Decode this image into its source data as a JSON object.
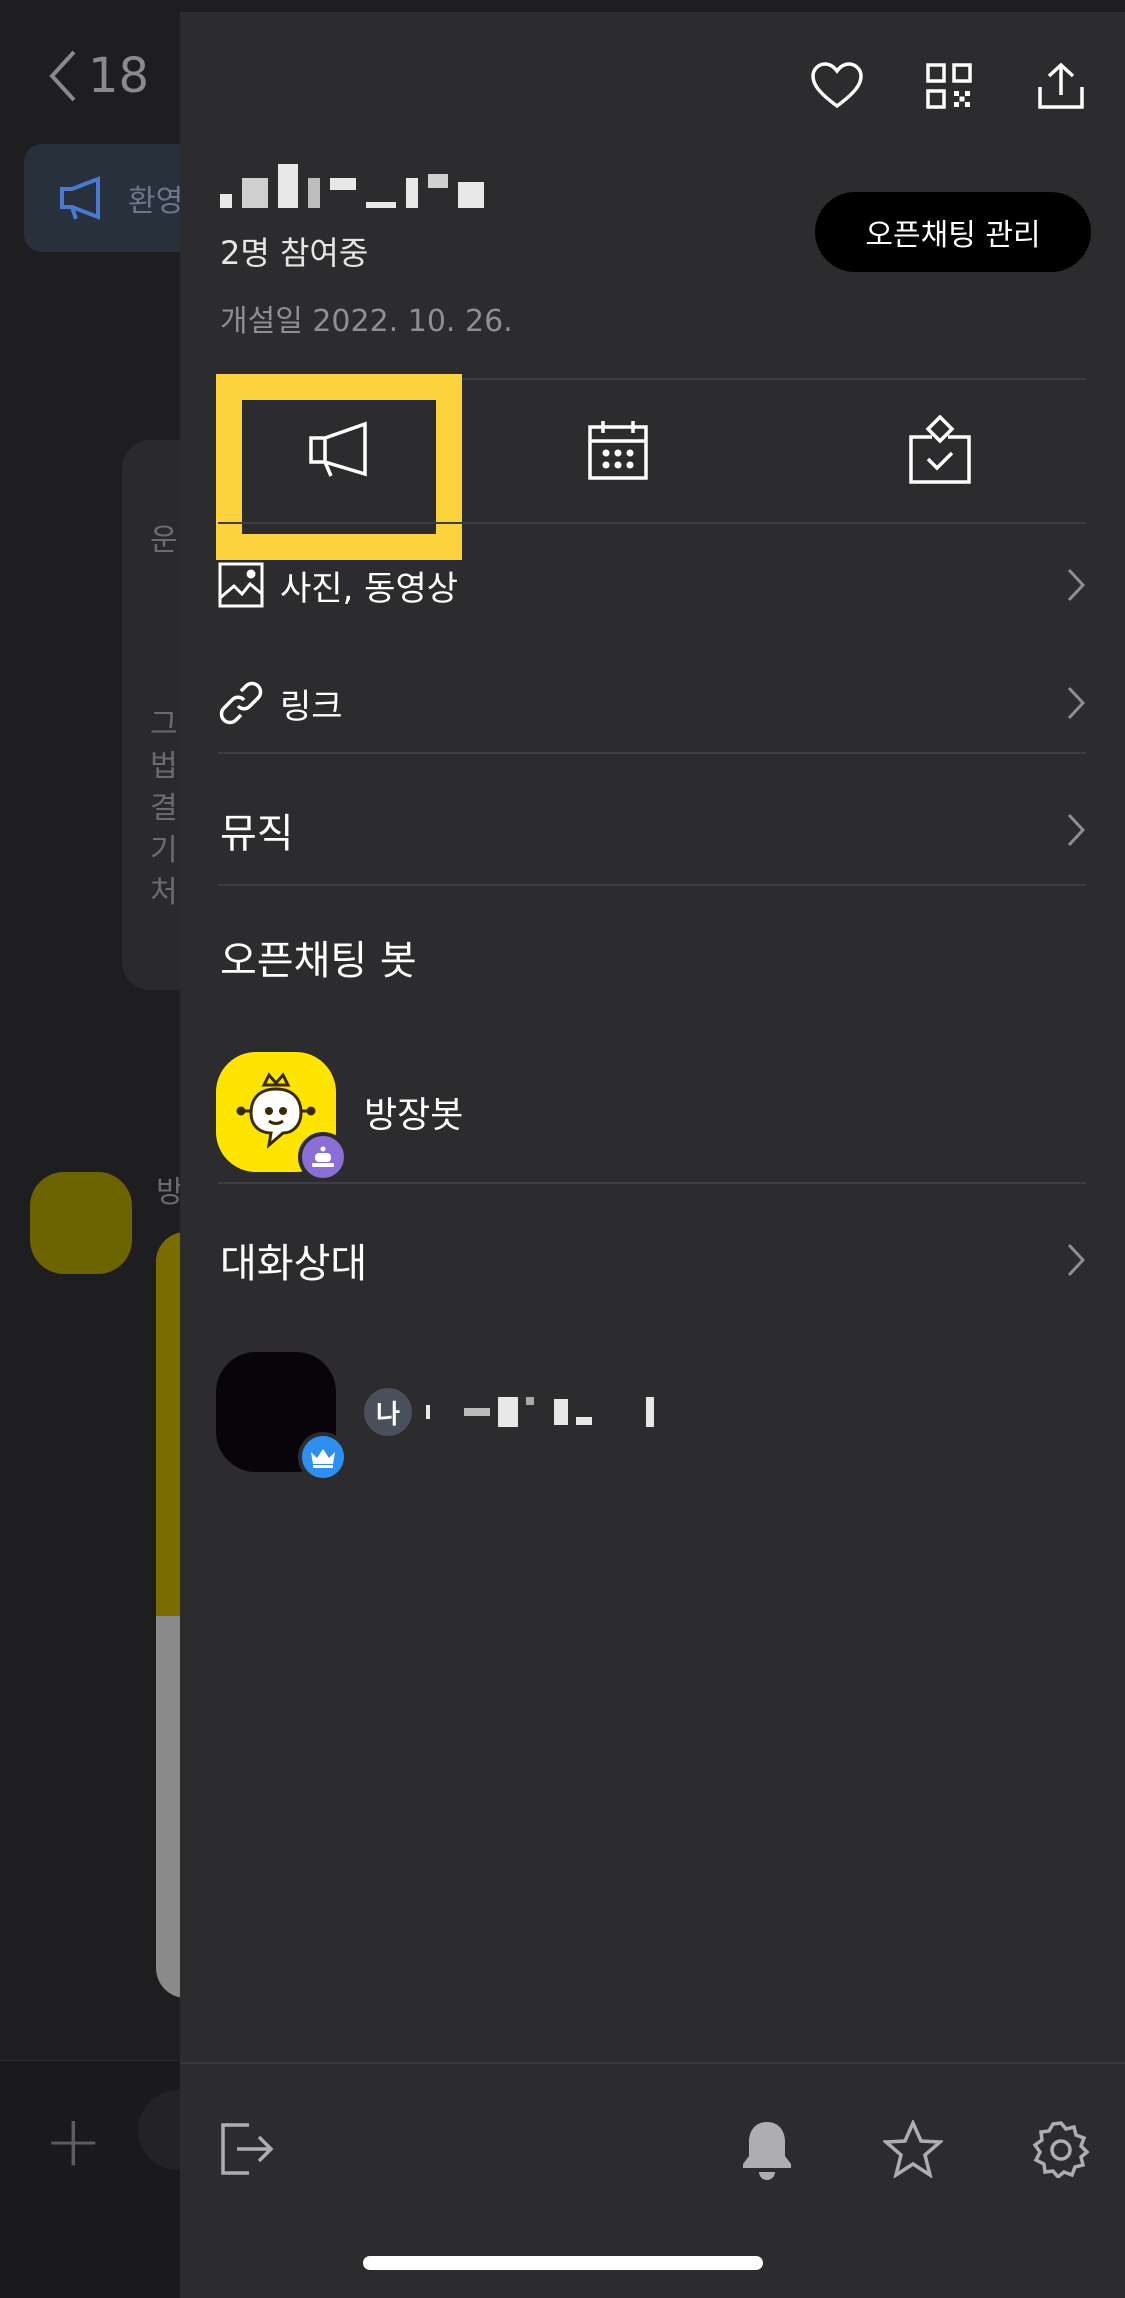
{
  "background": {
    "back_count": "18",
    "notice_text": "환영",
    "card_text": [
      "운",
      "그",
      "법",
      "결",
      "기",
      "처"
    ],
    "avatar_label": "방"
  },
  "header": {
    "icons": [
      "heart-icon",
      "qr-code-icon",
      "share-icon"
    ]
  },
  "room": {
    "participants": "2명 참여중",
    "created": "개설일 2022. 10. 26.",
    "manage_button": "오픈채팅 관리"
  },
  "tools": [
    "announcement-icon",
    "calendar-icon",
    "vote-icon"
  ],
  "menu": {
    "photos_videos": "사진, 동영상",
    "links": "링크",
    "music": "뮤직"
  },
  "bots": {
    "section_title": "오픈채팅 봇",
    "bot_name": "방장봇"
  },
  "members": {
    "section_title": "대화상대",
    "me_badge": "나"
  },
  "bottom_bar": {
    "icons": [
      "exit-icon",
      "bell-icon",
      "star-icon",
      "settings-icon"
    ]
  },
  "colors": {
    "highlight": "#fdd33b",
    "drawer_bg": "#2c2c2e",
    "bot_yellow": "#fee500",
    "bot_badge": "#8b6fd6",
    "crown_badge": "#2f8ff0"
  }
}
